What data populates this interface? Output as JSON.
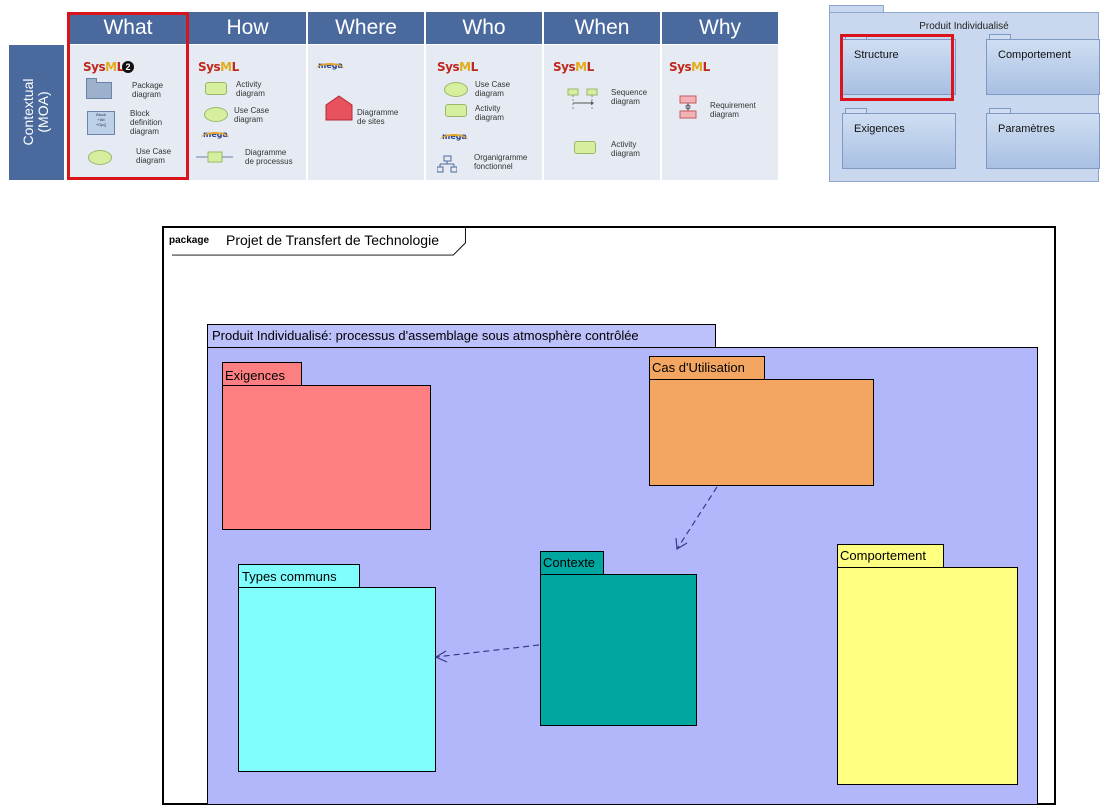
{
  "matrix": {
    "side_label_line1": "Contextual",
    "side_label_line2": "(MOA)",
    "columns": [
      "What",
      "How",
      "Where",
      "Who",
      "When",
      "Why"
    ],
    "what": {
      "logo": "SysML",
      "step_number": "2",
      "package_label": [
        "Package",
        "diagram"
      ],
      "block_label": [
        "Block",
        "definition",
        "diagram"
      ],
      "usecase_label": [
        "Use Case",
        "diagram"
      ],
      "block_icon_text": [
        "Block",
        "+Att",
        "+Op()"
      ]
    },
    "how": {
      "logo": "SysML",
      "activity_label": [
        "Activity",
        "diagram"
      ],
      "usecase_label": [
        "Use Case",
        "diagram"
      ],
      "mega_logo": "mega",
      "process_label": [
        "Diagramme",
        "de processus"
      ]
    },
    "where": {
      "mega_logo": "mega",
      "sites_label": [
        "Diagramme",
        "de sites"
      ]
    },
    "who": {
      "logo": "SysML",
      "usecase_label": [
        "Use Case",
        "diagram"
      ],
      "activity_label": [
        "Activity",
        "diagram"
      ],
      "mega_logo": "mega",
      "org_label": [
        "Organigramme",
        "fonctionnel"
      ]
    },
    "when": {
      "logo": "SysML",
      "sequence_label": [
        "Sequence",
        "diagram"
      ],
      "activity_label": [
        "Activity",
        "diagram"
      ]
    },
    "why": {
      "logo": "SysML",
      "requirement_label": [
        "Requirement",
        "diagram"
      ]
    }
  },
  "produit_panel": {
    "title": "Produit Individualisé",
    "packages": [
      "Structure",
      "Comportement",
      "Exigences",
      "Paramètres"
    ]
  },
  "diagram": {
    "frame_keyword": "package",
    "frame_title": "Projet de Transfert de Technologie",
    "outer_package": "Produit Individualisé: processus d'assemblage sous atmosphère contrôlée",
    "packages": {
      "exigences": "Exigences",
      "cas_utilisation": "Cas d'Utilisation",
      "contexte": "Contexte",
      "types_communs": "Types communs",
      "comportement": "Comportement"
    },
    "colors": {
      "outer": "#b2b6fa",
      "exigences": "#fd7f82",
      "cas_utilisation": "#f2a662",
      "contexte": "#00a7a0",
      "types_communs": "#7ffefd",
      "comportement": "#fefe80"
    },
    "dependencies": [
      {
        "from": "Cas d'Utilisation",
        "to": "Contexte"
      },
      {
        "from": "Contexte",
        "to": "Types communs"
      }
    ]
  }
}
